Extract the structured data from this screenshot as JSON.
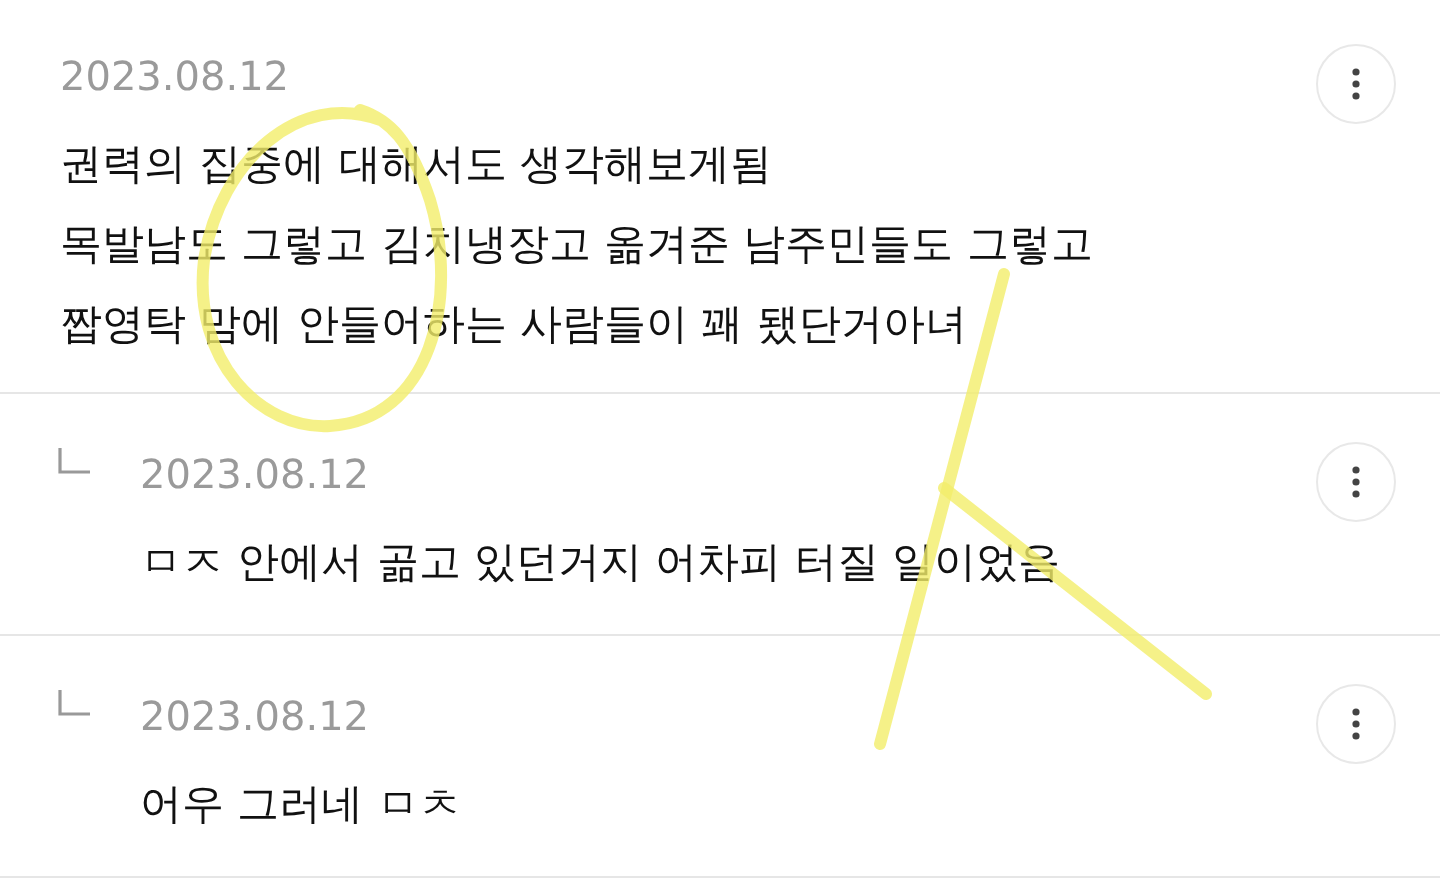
{
  "comments": [
    {
      "kind": "comment",
      "date": "2023.08.12",
      "lines": [
        "권력의 집중에 대해서도 생각해보게됨",
        "목발남도 그렇고 김치냉장고 옮겨준 남주민들도 그렇고",
        "짭영탁 맘에 안들어하는 사람들이 꽤 됐단거아녀"
      ]
    },
    {
      "kind": "reply",
      "date": "2023.08.12",
      "lines": [
        "ㅁㅈ 안에서 곪고 있던거지 어차피 터질 일이었음"
      ]
    },
    {
      "kind": "reply",
      "date": "2023.08.12",
      "lines": [
        "어우 그러네 ㅁㅊ"
      ]
    }
  ]
}
